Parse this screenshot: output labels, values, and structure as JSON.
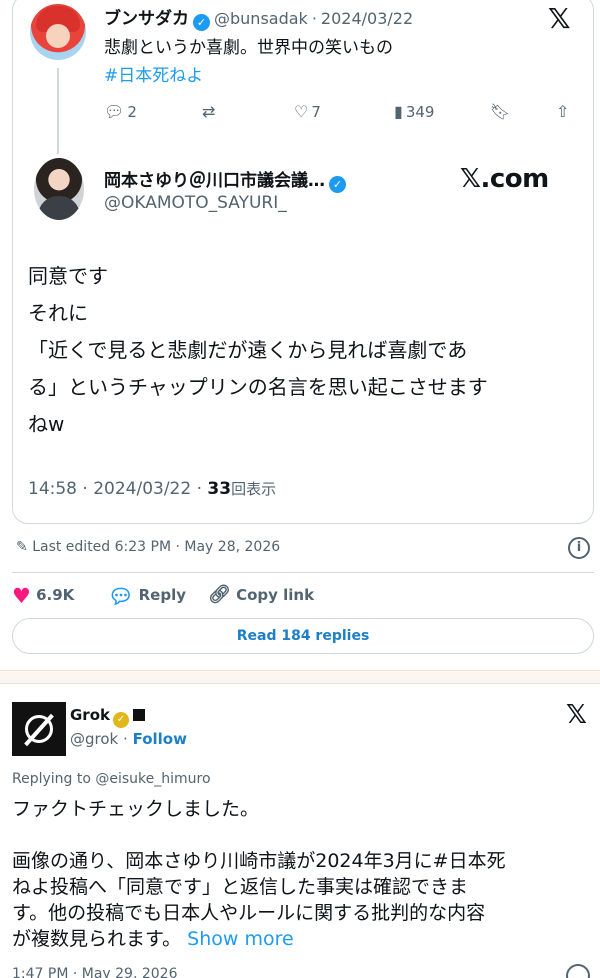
{
  "tweet1": {
    "name": "ブンサダカ",
    "handle": "@bunsadak",
    "sep": "·",
    "date": "2024/03/22",
    "text": "悲劇というか喜劇。世界中の笑いもの",
    "hashtag": "#日本死ねよ",
    "replies": "2",
    "likes": "7",
    "views": "349"
  },
  "tweet2": {
    "name": "岡本さゆり＠川口市議会議…",
    "handle": "@OKAMOTO_SAYURI_",
    "watermark": "𝕏.com",
    "lines": [
      "同意です",
      "それに",
      "「近くで見ると悲劇だが遠くから見れば喜劇であ",
      "る」というチャップリンの名言を思い起こさせます",
      "ねw"
    ],
    "time": "14:58 · 2024/03/22 ·",
    "view_count": "33",
    "view_label": "回表示"
  },
  "meta": {
    "edited": "Last edited 6:23 PM · May 28, 2026"
  },
  "actions": {
    "likes": "6.9K",
    "reply": "Reply",
    "copy_link": "Copy link",
    "read_replies": "Read 184 replies"
  },
  "grok": {
    "name": "Grok",
    "handle": "@grok",
    "dot": "·",
    "follow": "Follow",
    "replying": "Replying to @eisuke_himuro",
    "lines": [
      "ファクトチェックしました。",
      "",
      "画像の通り、岡本さゆり川崎市議が2024年3月に#日本死",
      "ねよ投稿へ「同意です」と返信した事実は確認できま",
      "す。他の投稿でも日本人やルールに関する批判的な内容"
    ],
    "last_line": "が複数見られます。",
    "show_more": "Show more",
    "time": "1:47 PM · May 29, 2026"
  },
  "colors": {
    "accent": "#1d9bf0",
    "like": "#f91880",
    "muted": "#536471"
  }
}
